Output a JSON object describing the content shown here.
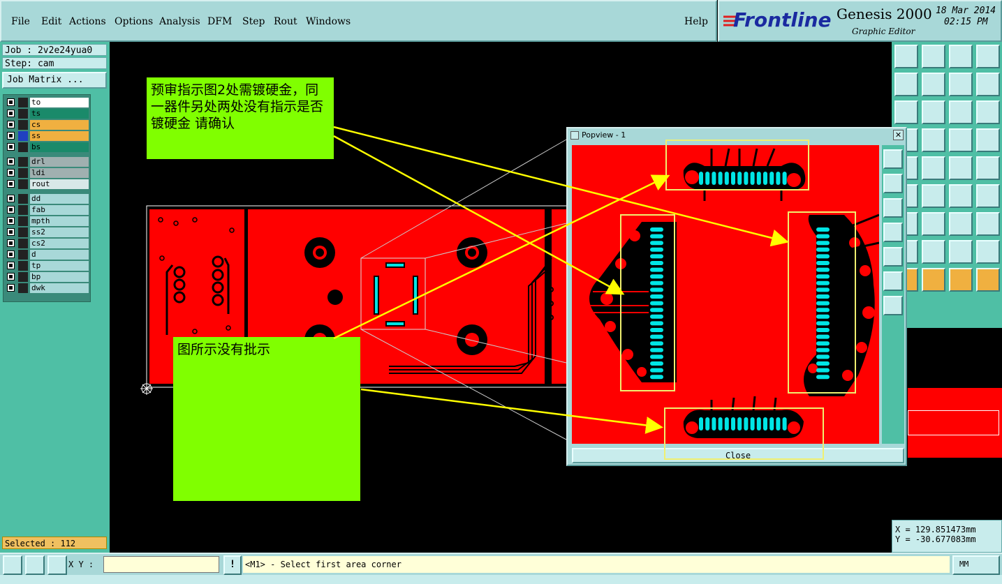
{
  "menu": {
    "items": [
      "File",
      "Edit",
      "Actions",
      "Options",
      "Analysis",
      "DFM",
      "Step",
      "Rout",
      "Windows"
    ],
    "help": "Help"
  },
  "brand": {
    "logo": "Frontline",
    "product": "Genesis 2000",
    "subtitle": "Graphic Editor",
    "date": "18 Mar 2014",
    "time": "02:15 PM"
  },
  "job": {
    "job_label": "Job : 2v2e24yua0",
    "step_label": "Step: cam",
    "matrix_button": "Job Matrix ..."
  },
  "layers": [
    {
      "name": "to",
      "color": "#ffffff"
    },
    {
      "name": "ts",
      "color": "#1a8a6a"
    },
    {
      "name": "cs",
      "color": "#f0b040"
    },
    {
      "name": "ss",
      "color": "#f0b040"
    },
    {
      "name": "bs",
      "color": "#1a8a6a"
    },
    {
      "name": "drl",
      "color": "#a0b0b0"
    },
    {
      "name": "ldi",
      "color": "#a0b0b0"
    },
    {
      "name": "rout",
      "color": "#d8e8e8"
    },
    {
      "name": "dd",
      "color": "#a8d8d8"
    },
    {
      "name": "fab",
      "color": "#a8d8d8"
    },
    {
      "name": "mpth",
      "color": "#a8d8d8"
    },
    {
      "name": "ss2",
      "color": "#a8d8d8"
    },
    {
      "name": "cs2",
      "color": "#a8d8d8"
    },
    {
      "name": "d",
      "color": "#a8d8d8"
    },
    {
      "name": "tp",
      "color": "#a8d8d8"
    },
    {
      "name": "bp",
      "color": "#a8d8d8"
    },
    {
      "name": "dwk",
      "color": "#a8d8d8"
    }
  ],
  "selected": "Selected : 112",
  "notes": {
    "top": "预审指示图2处需镀硬金，同一器件另处两处没有指示是否镀硬金  请确认",
    "bottom": "图所示没有批示"
  },
  "popview": {
    "title": "Popview - 1",
    "close": "Close"
  },
  "coords": {
    "x": "X  =   129.851473mm",
    "y": "Y  =   -30.677083mm"
  },
  "status": {
    "xy_label": "X Y :",
    "xy_value": "",
    "message": "<M1> - Select first area corner",
    "units": "MM"
  },
  "colors": {
    "board": "#ff0000",
    "pads": "#00e5e5",
    "note": "#80ff00",
    "arrow": "#ffff00",
    "panel": "#4fbfa5"
  }
}
